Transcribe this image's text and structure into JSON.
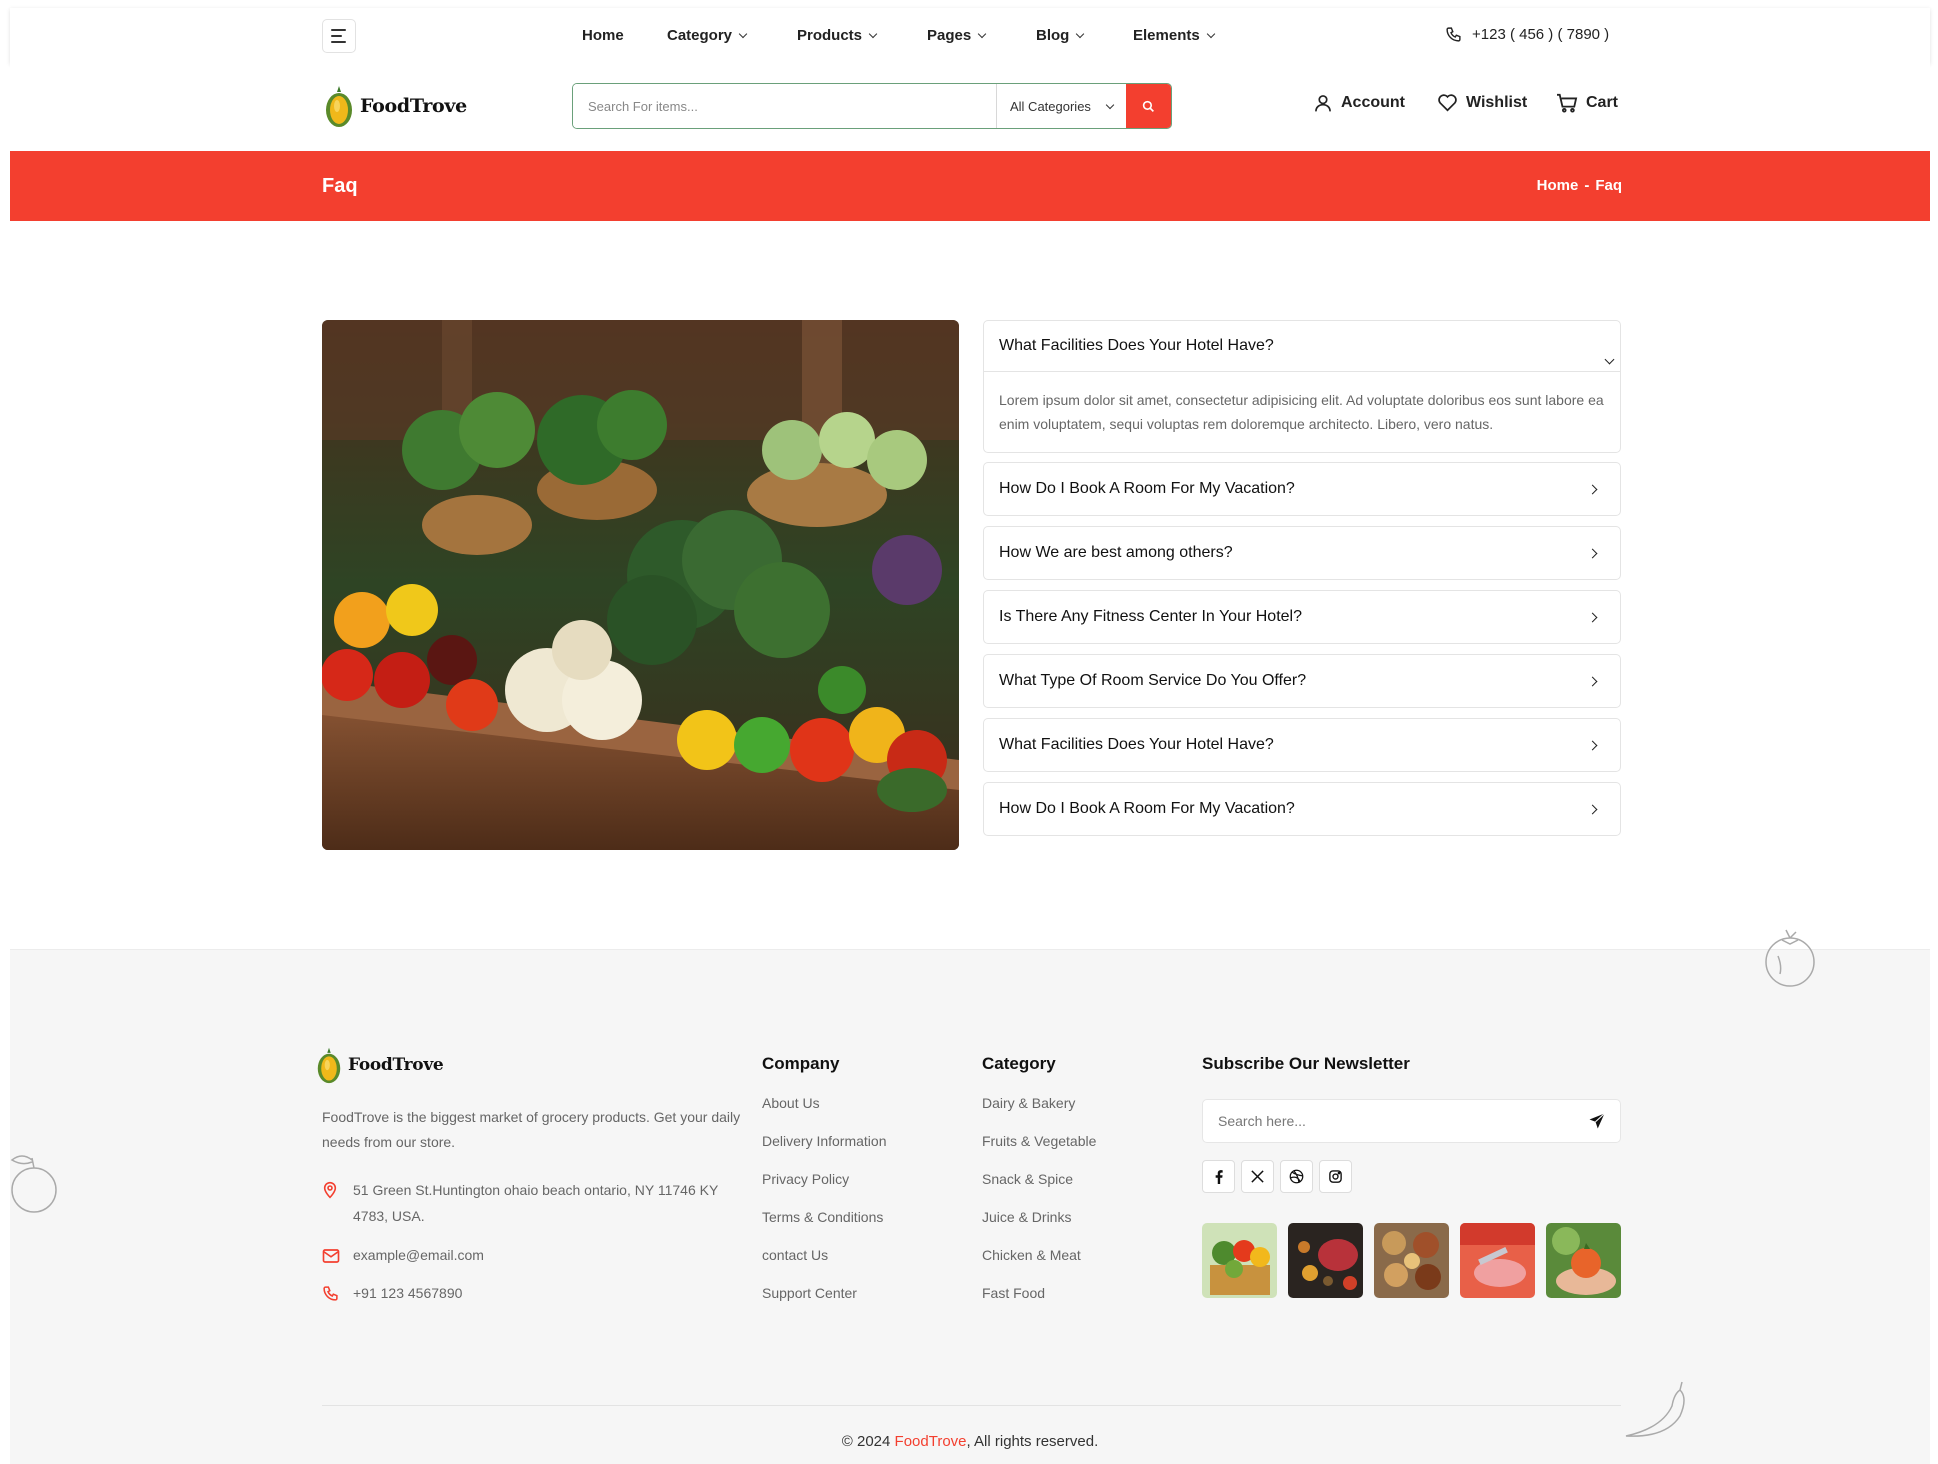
{
  "colors": {
    "accent": "#f33f2f",
    "footer_bg": "#f6f6f6",
    "search_border": "#6aa07a"
  },
  "topnav": {
    "menu_icon": "hamburger-icon",
    "links": [
      {
        "label": "Home",
        "dropdown": false
      },
      {
        "label": "Category",
        "dropdown": true
      },
      {
        "label": "Products",
        "dropdown": true
      },
      {
        "label": "Pages",
        "dropdown": true
      },
      {
        "label": "Blog",
        "dropdown": true
      },
      {
        "label": "Elements",
        "dropdown": true
      }
    ],
    "phone": "+123 ( 456 ) ( 7890 )"
  },
  "header": {
    "logo_text": "FoodTrove",
    "search_placeholder": "Search For items...",
    "category_select": "All Categories",
    "account": "Account",
    "wishlist": "Wishlist",
    "cart": "Cart"
  },
  "banner": {
    "title": "Faq",
    "breadcrumb_home": "Home",
    "breadcrumb_sep": "-",
    "breadcrumb_current": "Faq"
  },
  "faq": {
    "image_alt": "vegetables-market-image",
    "items": [
      {
        "question": "What Facilities Does Your Hotel Have?",
        "answer": "Lorem ipsum dolor sit amet, consectetur adipisicing elit. Ad voluptate doloribus eos sunt labore ea enim voluptatem, sequi voluptas rem doloremque architecto. Libero, vero natus.",
        "open": true
      },
      {
        "question": "How Do I Book A Room For My Vacation?",
        "open": false
      },
      {
        "question": "How We are best among others?",
        "open": false
      },
      {
        "question": "Is There Any Fitness Center In Your Hotel?",
        "open": false
      },
      {
        "question": "What Type Of Room Service Do You Offer?",
        "open": false
      },
      {
        "question": "What Facilities Does Your Hotel Have?",
        "open": false
      },
      {
        "question": "How Do I Book A Room For My Vacation?",
        "open": false
      }
    ]
  },
  "footer": {
    "logo_text": "FoodTrove",
    "description": "FoodTrove is the biggest market of grocery products. Get your daily needs from our store.",
    "address": "51 Green St.Huntington ohaio beach ontario, NY 11746 KY 4783, USA.",
    "email": "example@email.com",
    "phone": "+91 123 4567890",
    "company": {
      "heading": "Company",
      "links": [
        "About Us",
        "Delivery Information",
        "Privacy Policy",
        "Terms & Conditions",
        "contact Us",
        "Support Center"
      ]
    },
    "category": {
      "heading": "Category",
      "links": [
        "Dairy & Bakery",
        "Fruits & Vegetable",
        "Snack & Spice",
        "Juice & Drinks",
        "Chicken & Meat",
        "Fast Food"
      ]
    },
    "newsletter": {
      "heading": "Subscribe Our Newsletter",
      "placeholder": "Search here..."
    },
    "socials": [
      "facebook-icon",
      "x-twitter-icon",
      "dribbble-icon",
      "instagram-icon"
    ],
    "copyright_prefix": "© 2024",
    "copyright_brand": "FoodTrove",
    "copyright_suffix": ", All rights reserved."
  }
}
